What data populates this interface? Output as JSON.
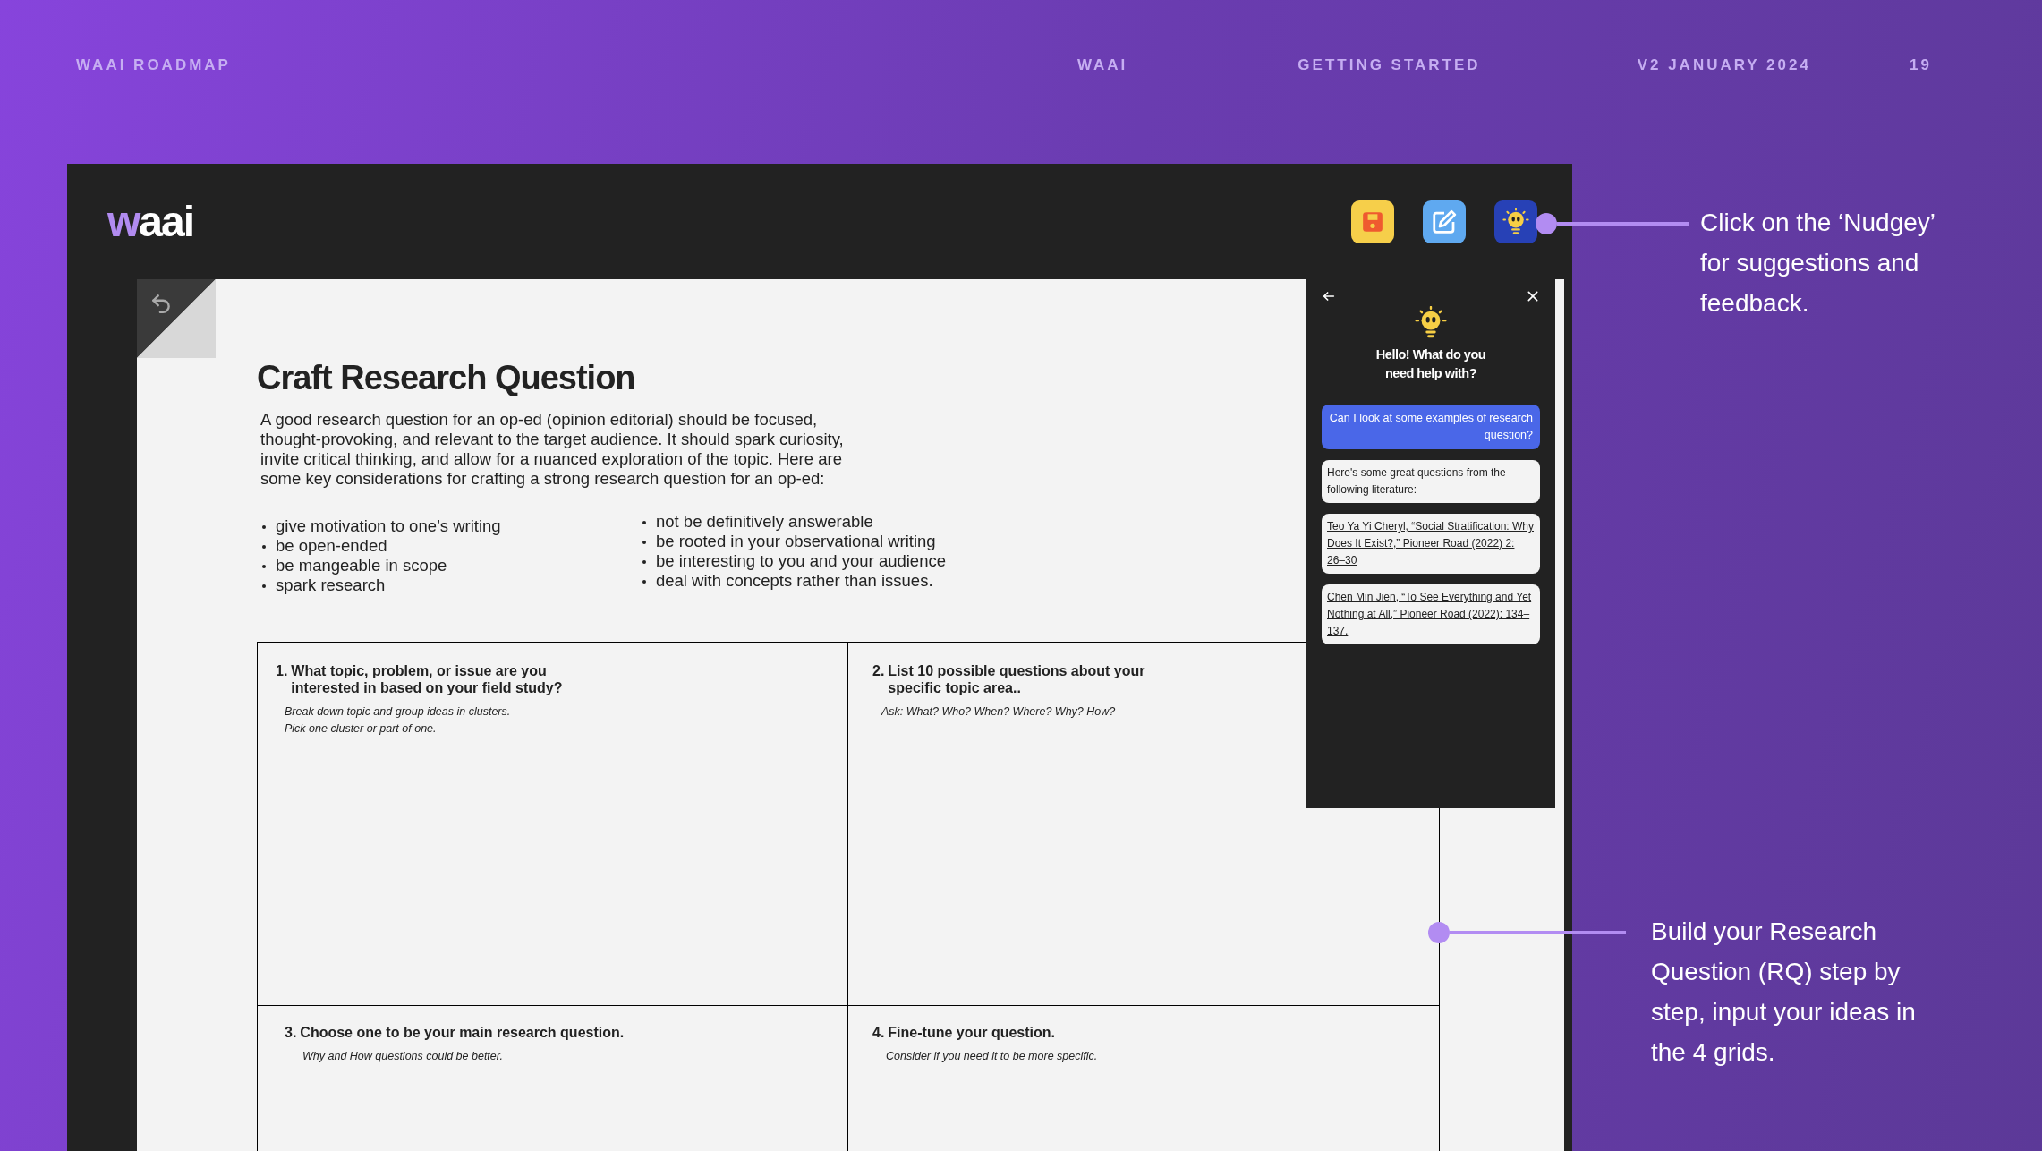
{
  "header": {
    "left": "WAAI ROADMAP",
    "items": [
      "WAAI",
      "GETTING STARTED",
      "V2 JANUARY 2024",
      "19"
    ]
  },
  "app": {
    "logo": {
      "mark": "w",
      "text": "aai"
    }
  },
  "document": {
    "title": "Craft Research Question",
    "intro": "A good research question for an op-ed (opinion editorial) should be focused, thought-provoking, and relevant to the target audience. It should spark curiosity, invite critical thinking, and allow for a nuanced exploration of the topic. Here are some key considerations for crafting a strong research question for an op-ed:",
    "bullets_left": [
      "give motivation to one’s writing",
      "be open-ended",
      "be mangeable in scope",
      "spark research"
    ],
    "bullets_right": [
      "not be definitively answerable",
      "be rooted in your observational writing",
      "be interesting to you and your audience",
      "deal with concepts rather than issues."
    ],
    "grid": [
      {
        "number": "1.",
        "heading": "What topic, problem, or issue are you interested in based on your field study?",
        "hints": [
          "Break down topic and group ideas in clusters.",
          "Pick one cluster or part of one."
        ]
      },
      {
        "number": "2.",
        "heading": "List 10 possible questions about your specific topic area..",
        "hints": [
          "Ask: What? Who? When? Where? Why? How?"
        ]
      },
      {
        "number": "3.",
        "heading": "Choose one to be your main research question.",
        "hints": [
          "Why and How questions could be better."
        ]
      },
      {
        "number": "4.",
        "heading": "Fine-tune your question.",
        "hints": [
          "Consider if you need it to be more specific."
        ]
      }
    ]
  },
  "nudgey": {
    "greeting": "Hello! What do you need help with?",
    "messages": [
      {
        "kind": "user",
        "text": "Can I look at some examples of research question?"
      },
      {
        "kind": "bot",
        "text": "Here's some great questions from the following literature:"
      },
      {
        "kind": "reference",
        "text": "Teo Ya Yi Cheryl, “Social Stratification: Why Does It Exist?,” Pioneer Road (2022) 2: 26–30"
      },
      {
        "kind": "reference",
        "text": "Chen Min Jien, “To See Everything and Yet Nothing at All,” Pioneer Road (2022): 134–137."
      }
    ]
  },
  "callouts": [
    "Click on the ‘Nudgey’ for suggestions and feedback.",
    "Build your Research Question (RQ) step by step, input your ideas in the 4 grids."
  ]
}
